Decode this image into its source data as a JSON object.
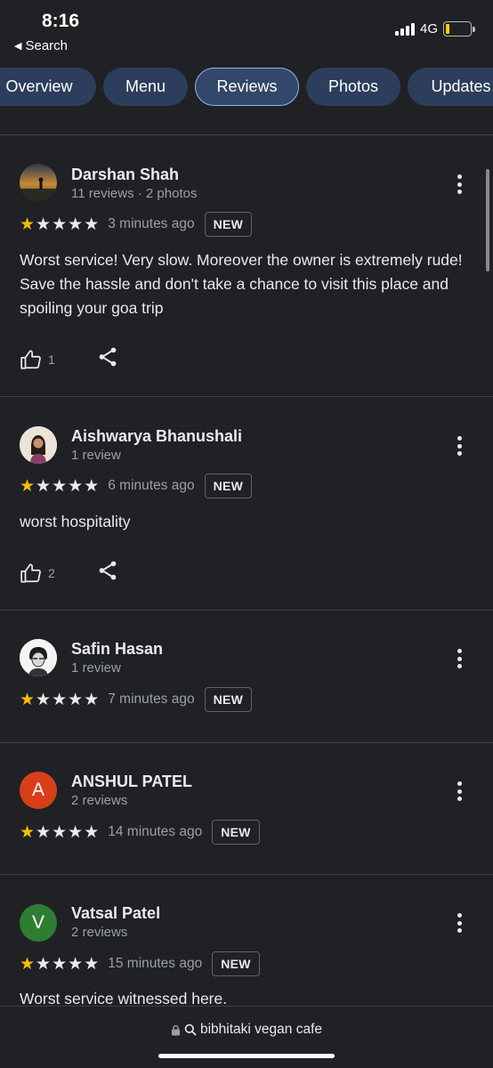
{
  "status_bar": {
    "time": "8:16",
    "back_label": "Search",
    "network": "4G",
    "battery_level": 0.15,
    "battery_color": "#ffd400"
  },
  "tabs": [
    {
      "label": "Overview",
      "active": false
    },
    {
      "label": "Menu",
      "active": false
    },
    {
      "label": "Reviews",
      "active": true
    },
    {
      "label": "Photos",
      "active": false
    },
    {
      "label": "Updates",
      "active": false
    }
  ],
  "reviews": [
    {
      "name": "Darshan Shah",
      "meta": "11 reviews · 2 photos",
      "avatar": "photo",
      "rating": 1,
      "time": "3 minutes ago",
      "badge": "NEW",
      "text": "Worst service! Very slow. Moreover the owner is extremely rude! Save the hassle and don't take a chance to visit this place and spoiling your goa trip",
      "likes": "1"
    },
    {
      "name": "Aishwarya Bhanushali",
      "meta": "1 review",
      "avatar": "photo",
      "rating": 1,
      "time": "6 minutes ago",
      "badge": "NEW",
      "text": "worst hospitality",
      "likes": "2"
    },
    {
      "name": "Safin Hasan",
      "meta": "1 review",
      "avatar": "photo",
      "rating": 1,
      "time": "7 minutes ago",
      "badge": "NEW"
    },
    {
      "name": "ANSHUL PATEL",
      "meta": "2 reviews",
      "avatar_letter": "A",
      "avatar_color": "#d93e1b",
      "rating": 1,
      "time": "14 minutes ago",
      "badge": "NEW"
    },
    {
      "name": "Vatsal Patel",
      "meta": "2 reviews",
      "avatar_letter": "V",
      "avatar_color": "#2e7d32",
      "rating": 1,
      "time": "15 minutes ago",
      "badge": "NEW",
      "text": "Worst service witnessed here."
    }
  ],
  "bottom": {
    "url": "bibhitaki vegan cafe"
  },
  "colors": {
    "background": "#202124",
    "star_filled": "#fbbc04",
    "tab_bg": "#2c3e5c",
    "tab_active_border": "#8ab4f8"
  }
}
